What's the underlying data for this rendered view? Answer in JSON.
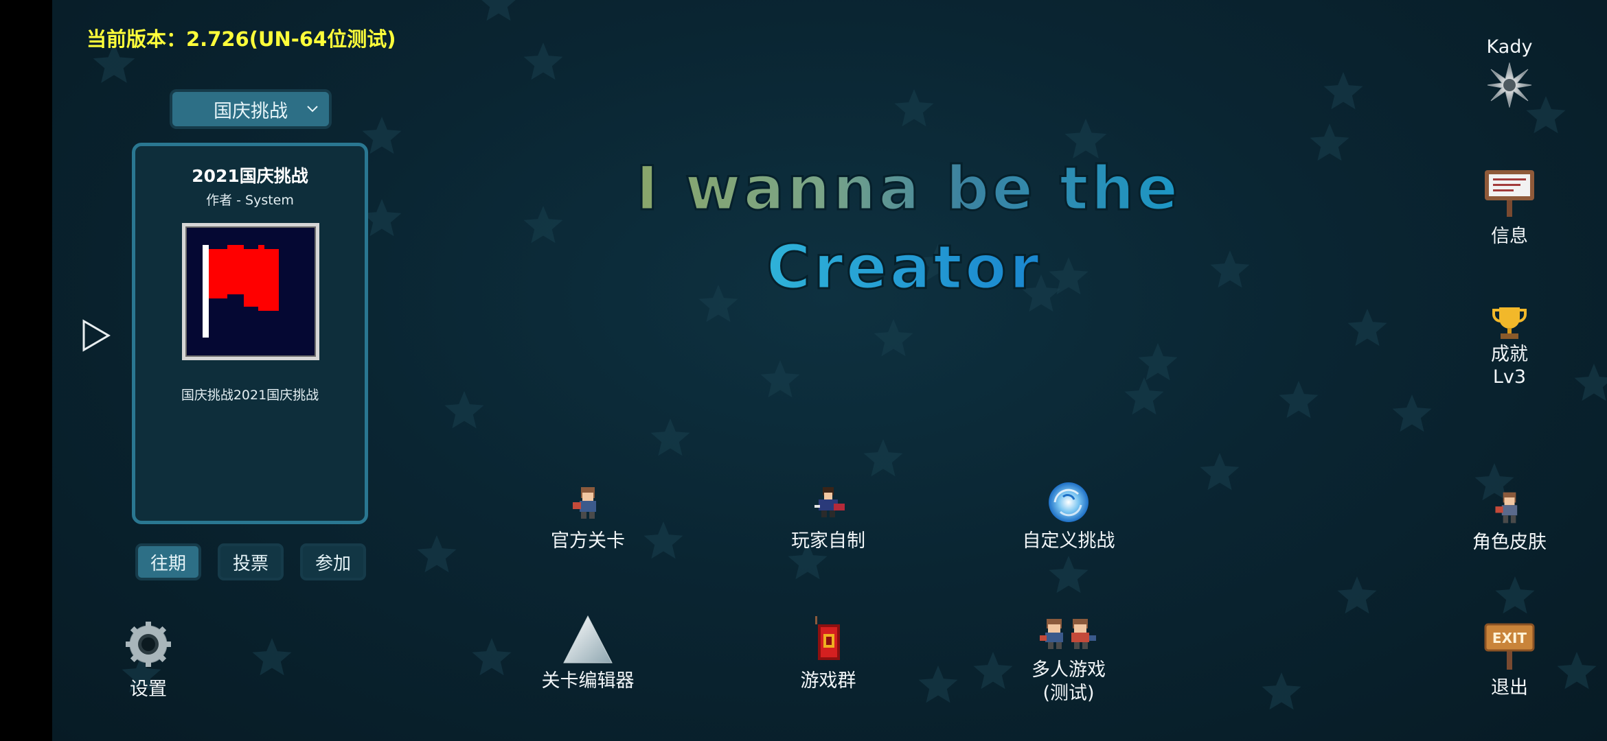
{
  "version_text": "当前版本：2.726(UN-64位测试)",
  "dropdown": {
    "selected": "国庆挑战"
  },
  "challenge_card": {
    "title": "2021国庆挑战",
    "author": "作者 - System",
    "description": "国庆挑战2021国庆挑战"
  },
  "tabs": [
    "往期",
    "投票",
    "参加"
  ],
  "active_tab": "往期",
  "game_title": {
    "line1": "I wanna be the",
    "line2": "Creator"
  },
  "user": {
    "name": "Kady"
  },
  "right_menu": {
    "info": "信息",
    "achievement": "成就",
    "achievement_level": "Lv3",
    "skins": "角色皮肤",
    "exit": "退出"
  },
  "main_menu": {
    "official_levels": "官方关卡",
    "player_made": "玩家自制",
    "custom_challenge": "自定义挑战",
    "level_editor": "关卡编辑器",
    "game_group": "游戏群",
    "multiplayer": "多人游戏",
    "multiplayer_note": "(测试)"
  },
  "settings": "设置",
  "colors": {
    "version_yellow": "#ffff3a",
    "button_teal": "#2d6f86",
    "card_border": "#2a7791",
    "flag_red": "#ff0000",
    "background": "#0a2532"
  },
  "icons": {
    "play": "play-arrow-icon",
    "gear": "gear-icon",
    "badge": "spiked-star-icon",
    "sign": "info-sign-icon",
    "trophy": "trophy-icon",
    "exit_sign": "exit-sign-icon"
  }
}
